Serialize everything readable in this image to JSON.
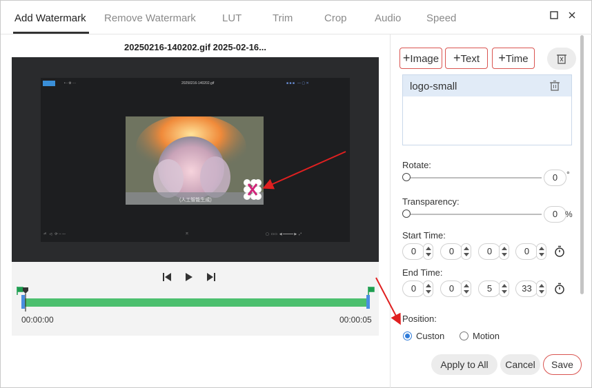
{
  "tabs": [
    {
      "label": "Add Watermark"
    },
    {
      "label": "Remove Watermark"
    },
    {
      "label": "LUT"
    },
    {
      "label": "Trim"
    },
    {
      "label": "Crop"
    },
    {
      "label": "Audio"
    },
    {
      "label": "Speed"
    }
  ],
  "active_tab": "Add Watermark",
  "window_controls": {
    "maximize_icon": "square-icon",
    "close_icon": "close-icon"
  },
  "preview": {
    "filename": "20250216-140202.gif 2025-02-16...",
    "inner_title": "20250216-140202.gif",
    "inner_subtitle": "(人工智能生成)"
  },
  "playback": {
    "prev_icon": "skip-back-icon",
    "play_icon": "play-icon",
    "next_icon": "skip-forward-icon",
    "start_time": "00:00:00",
    "end_time": "00:00:05"
  },
  "watermark_actions": {
    "image_label": "Image",
    "text_label": "Text",
    "time_label": "Time"
  },
  "watermark_list": [
    {
      "name": "logo-small"
    }
  ],
  "rotate": {
    "label": "Rotate:",
    "value": "0",
    "unit": "°",
    "level": 0
  },
  "transparency": {
    "label": "Transparency:",
    "value": "0",
    "unit": "%",
    "level": 0
  },
  "start_time": {
    "label": "Start Time:",
    "fields": [
      "0",
      "0",
      "0",
      "0"
    ]
  },
  "end_time": {
    "label": "End Time:",
    "fields": [
      "0",
      "0",
      "5",
      "33"
    ]
  },
  "position": {
    "label": "Position:",
    "options": [
      {
        "label": "Custon",
        "selected": true
      },
      {
        "label": "Motion",
        "selected": false
      }
    ]
  },
  "footer": {
    "apply_all_label": "Apply to All",
    "cancel_label": "Cancel",
    "save_label": "Save"
  },
  "colors": {
    "accent_red": "#d9534f",
    "timeline_green": "#4cbf6e",
    "radio_blue": "#2f7bd9",
    "annotation_arrow": "#e02020"
  }
}
